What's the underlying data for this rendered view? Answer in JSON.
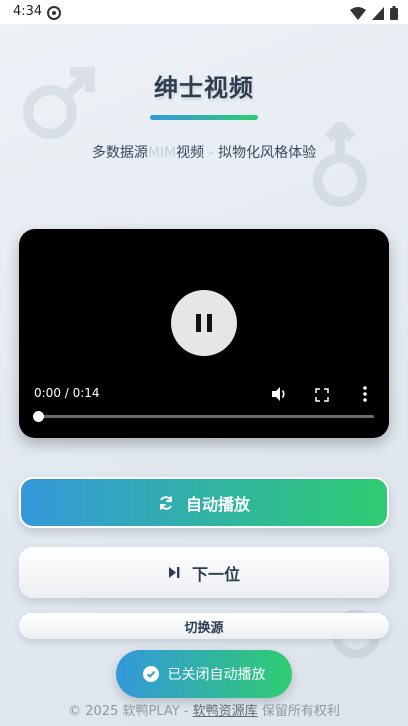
{
  "status_bar": {
    "time": "4:34"
  },
  "header": {
    "title": "绅士视频",
    "subtitle_main": "多数据源",
    "subtitle_faint": "MIM",
    "subtitle_mid": "视频",
    "subtitle_sep": " - ",
    "subtitle_end": "拟物化风格体验"
  },
  "player": {
    "time_display": "0:00 / 0:14",
    "progress": 0.0
  },
  "buttons": {
    "auto_play_label": "自动播放",
    "next_label": "下一位",
    "switch_source_label": "切换源"
  },
  "toast": {
    "message": "已关闭自动播放"
  },
  "footer": {
    "prefix": "© 2025 软鸭PLAY - ",
    "link": "软鸭资源库",
    "suffix": " 保留所有权利"
  },
  "colors": {
    "accent_blue": "#3498db",
    "accent_green": "#2ecc71",
    "text_dark": "#2c3e50"
  }
}
